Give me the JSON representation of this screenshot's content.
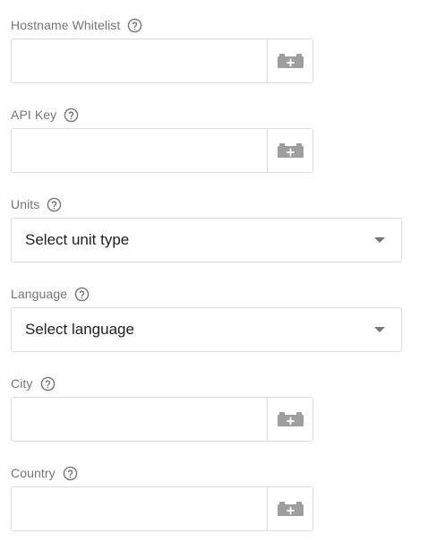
{
  "fields": [
    {
      "id": "hostname-whitelist",
      "label": "Hostname Whitelist",
      "type": "text",
      "value": ""
    },
    {
      "id": "api-key",
      "label": "API Key",
      "type": "text",
      "value": ""
    },
    {
      "id": "units",
      "label": "Units",
      "type": "select",
      "selected": "Select unit type"
    },
    {
      "id": "language",
      "label": "Language",
      "type": "select",
      "selected": "Select language"
    },
    {
      "id": "city",
      "label": "City",
      "type": "text",
      "value": ""
    },
    {
      "id": "country",
      "label": "Country",
      "type": "text",
      "value": ""
    }
  ],
  "icons": {
    "help": "help-circle-icon",
    "variable": "variable-brick-plus-icon",
    "dropdown": "caret-down-icon"
  },
  "colors": {
    "label": "#757575",
    "border": "#dadce0",
    "icon": "#9e9e9e",
    "text": "#202124"
  }
}
